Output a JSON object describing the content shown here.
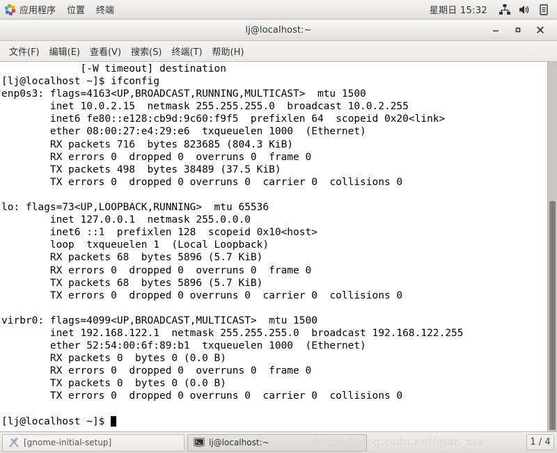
{
  "top_panel": {
    "apps_label": "应用程序",
    "places_label": "位置",
    "terminal_label": "终端",
    "apps_icon": "gnome-applications-icon",
    "clock": "星期日 15:32",
    "tray": [
      {
        "name": "network-icon"
      },
      {
        "name": "volume-icon"
      },
      {
        "name": "clipboard-icon"
      }
    ]
  },
  "window": {
    "title": "lj@localhost:~",
    "minimize_label": "−",
    "maximize_label": "□",
    "close_label": "×",
    "menus": [
      "文件(F)",
      "编辑(E)",
      "查看(V)",
      "搜索(S)",
      "终端(T)",
      "帮助(H)"
    ]
  },
  "terminal": {
    "lines": [
      "             [-W timeout] destination",
      "[lj@localhost ~]$ ifconfig",
      "enp0s3: flags=4163<UP,BROADCAST,RUNNING,MULTICAST>  mtu 1500",
      "        inet 10.0.2.15  netmask 255.255.255.0  broadcast 10.0.2.255",
      "        inet6 fe80::e128:cb9d:9c60:f9f5  prefixlen 64  scopeid 0x20<link>",
      "        ether 08:00:27:e4:29:e6  txqueuelen 1000  (Ethernet)",
      "        RX packets 716  bytes 823685 (804.3 KiB)",
      "        RX errors 0  dropped 0  overruns 0  frame 0",
      "        TX packets 498  bytes 38489 (37.5 KiB)",
      "        TX errors 0  dropped 0 overruns 0  carrier 0  collisions 0",
      "",
      "lo: flags=73<UP,LOOPBACK,RUNNING>  mtu 65536",
      "        inet 127.0.0.1  netmask 255.0.0.0",
      "        inet6 ::1  prefixlen 128  scopeid 0x10<host>",
      "        loop  txqueuelen 1  (Local Loopback)",
      "        RX packets 68  bytes 5896 (5.7 KiB)",
      "        RX errors 0  dropped 0  overruns 0  frame 0",
      "        TX packets 68  bytes 5896 (5.7 KiB)",
      "        TX errors 0  dropped 0 overruns 0  carrier 0  collisions 0",
      "",
      "virbr0: flags=4099<UP,BROADCAST,MULTICAST>  mtu 1500",
      "        inet 192.168.122.1  netmask 255.255.255.0  broadcast 192.168.122.255",
      "        ether 52:54:00:6f:89:b1  txqueuelen 1000  (Ethernet)",
      "        RX packets 0  bytes 0 (0.0 B)",
      "        RX errors 0  dropped 0  overruns 0  frame 0",
      "        TX packets 0  bytes 0 (0.0 B)",
      "        TX errors 0  dropped 0 overruns 0  carrier 0  collisions 0",
      ""
    ],
    "prompt": "[lj@localhost ~]$ "
  },
  "taskbar": {
    "items": [
      {
        "label": "[gnome-initial-setup]",
        "icon": "tools-icon",
        "active": false
      },
      {
        "label": "lj@localhost:~",
        "icon": "terminal-icon",
        "active": true
      }
    ],
    "watermark": "https://blog.csdn.net/qian_xia",
    "workspace": "1 / 4"
  },
  "colors": {
    "panel_bg": "#ebe9e7",
    "terminal_bg": "#ffffff",
    "terminal_fg": "#000000",
    "scrollbar_thumb": "#827f7b"
  }
}
